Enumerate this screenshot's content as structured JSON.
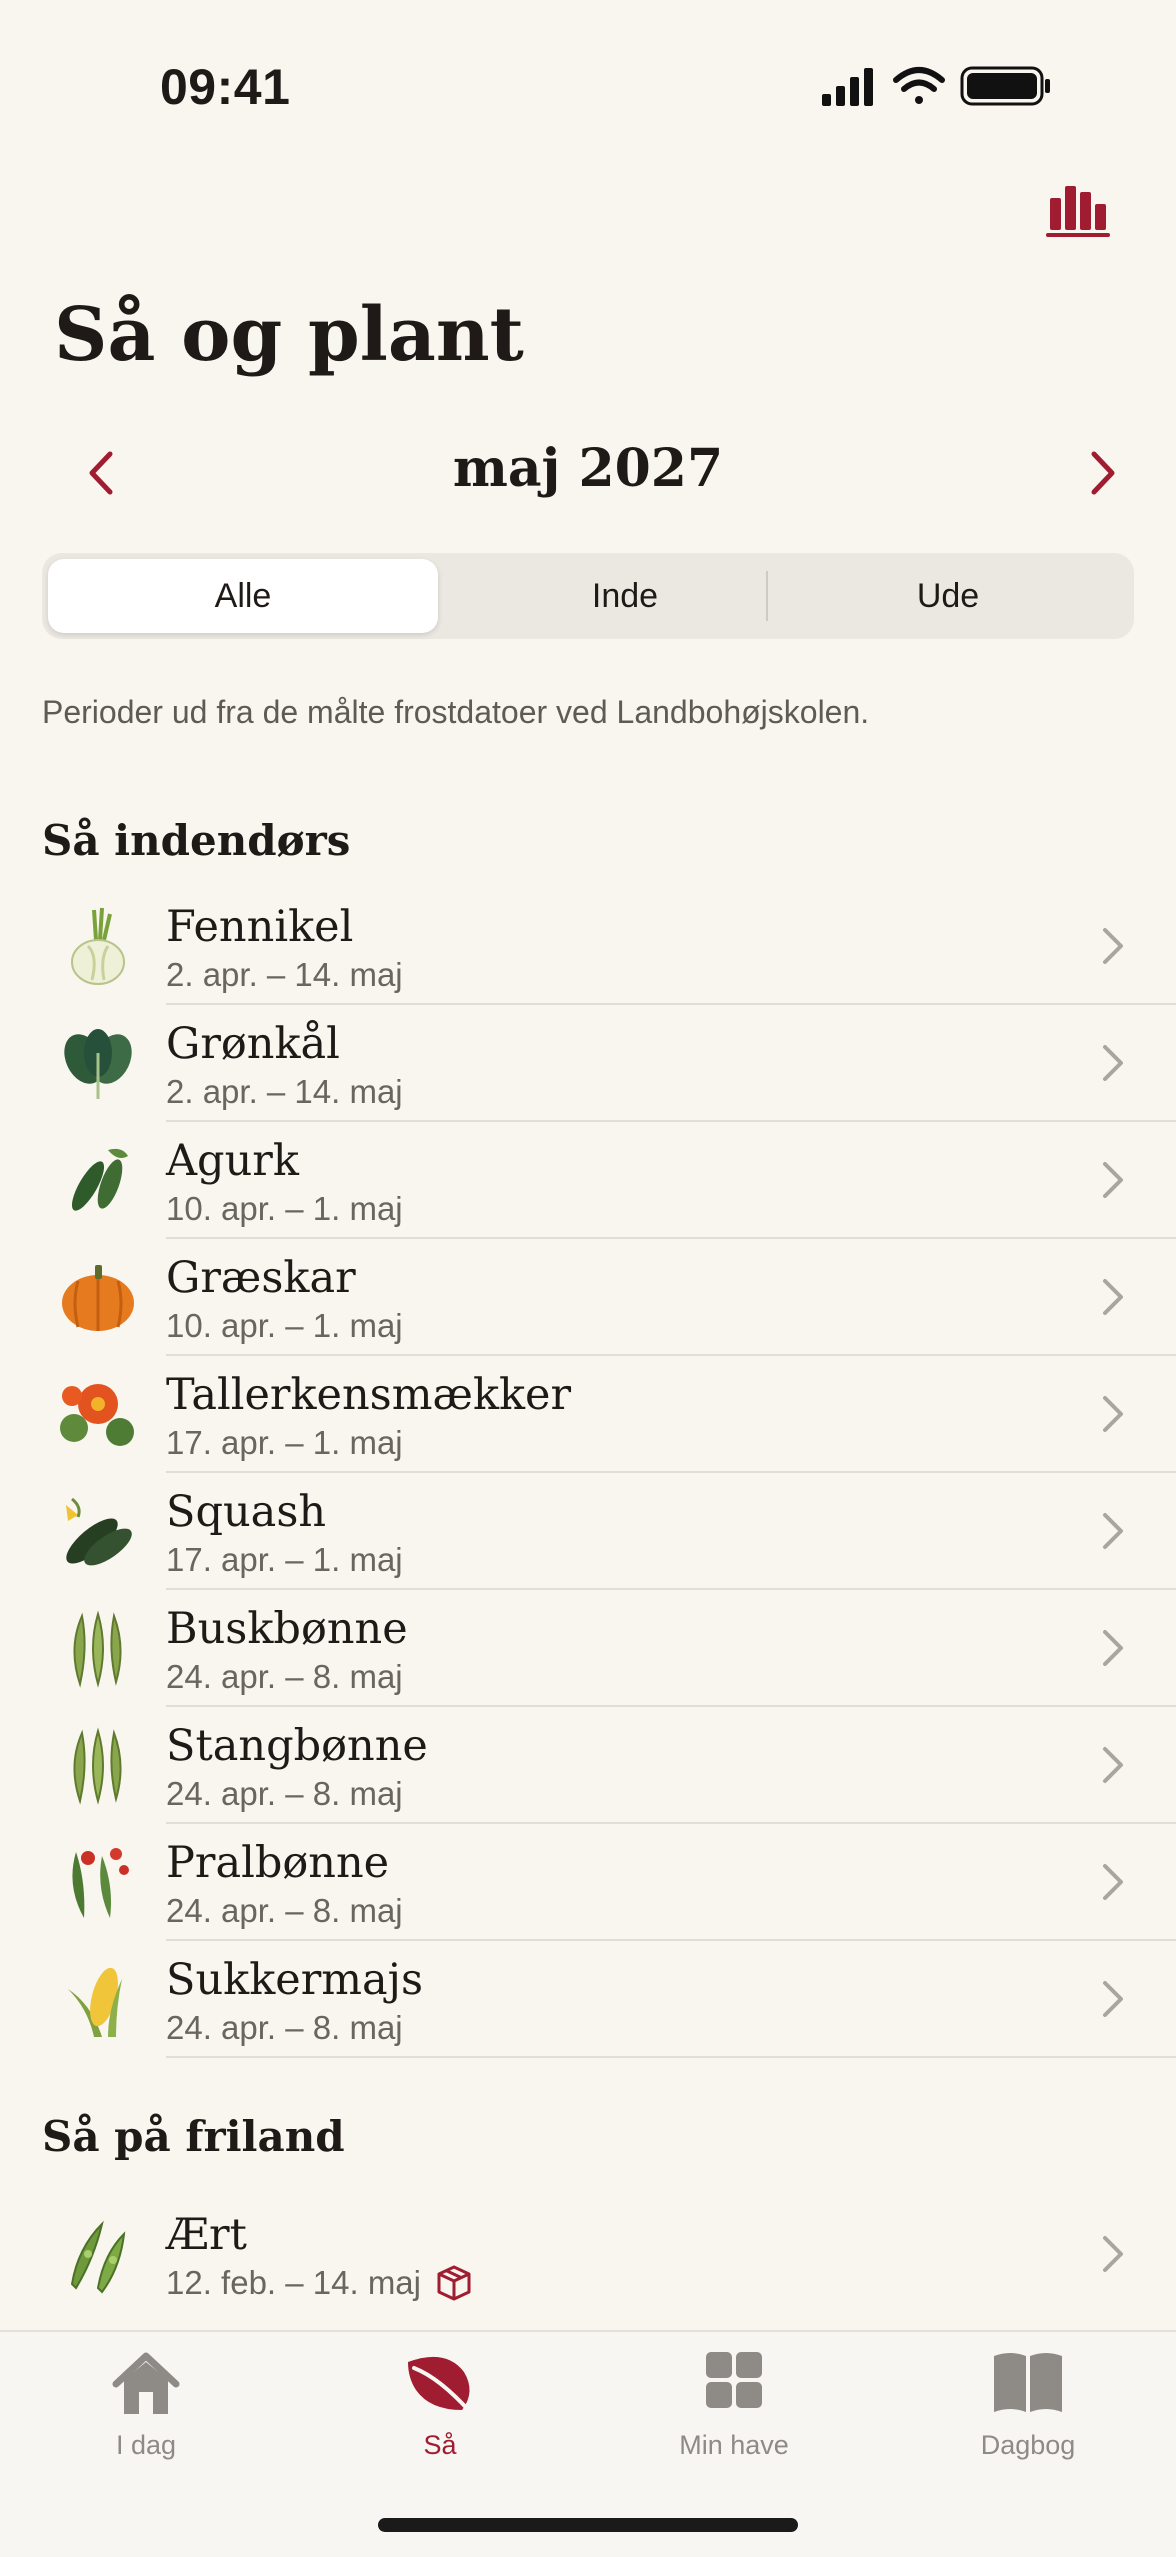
{
  "status": {
    "time": "09:41"
  },
  "header": {
    "title": "Så og plant",
    "month": "maj 2027",
    "stats_icon": "bar-chart-icon"
  },
  "filter": {
    "options": [
      "Alle",
      "Inde",
      "Ude"
    ],
    "selected": "Alle"
  },
  "info_text": "Perioder ud fra de målte frostdatoer ved Landbohøjskolen.",
  "sections": [
    {
      "title": "Så indendørs",
      "items": [
        {
          "name": "Fennikel",
          "dates": "2. apr. – 14. maj",
          "icon": "fennel"
        },
        {
          "name": "Grønkål",
          "dates": "2. apr. – 14. maj",
          "icon": "kale"
        },
        {
          "name": "Agurk",
          "dates": "10. apr. – 1. maj",
          "icon": "cucumber"
        },
        {
          "name": "Græskar",
          "dates": "10. apr. – 1. maj",
          "icon": "pumpkin"
        },
        {
          "name": "Tallerkensmækker",
          "dates": "17. apr. – 1. maj",
          "icon": "nasturtium"
        },
        {
          "name": "Squash",
          "dates": "17. apr. – 1. maj",
          "icon": "zucchini"
        },
        {
          "name": "Buskbønne",
          "dates": "24. apr. – 8. maj",
          "icon": "bean"
        },
        {
          "name": "Stangbønne",
          "dates": "24. apr. – 8. maj",
          "icon": "bean"
        },
        {
          "name": "Pralbønne",
          "dates": "24. apr. – 8. maj",
          "icon": "runner-bean"
        },
        {
          "name": "Sukkermajs",
          "dates": "24. apr. – 8. maj",
          "icon": "corn"
        }
      ]
    },
    {
      "title": "Så på friland",
      "items": [
        {
          "name": "Ært",
          "dates": "12. feb. – 14. maj",
          "icon": "pea",
          "badge_icon": "box-icon"
        }
      ]
    }
  ],
  "tabs": [
    {
      "label": "I dag",
      "icon": "house-icon"
    },
    {
      "label": "Så",
      "icon": "leaf-icon",
      "active": true
    },
    {
      "label": "Min have",
      "icon": "grid-icon"
    },
    {
      "label": "Dagbog",
      "icon": "book-icon"
    }
  ],
  "colors": {
    "accent": "#a01c30",
    "background": "#f9f5ef",
    "inactive_tab": "#8e8a86"
  }
}
